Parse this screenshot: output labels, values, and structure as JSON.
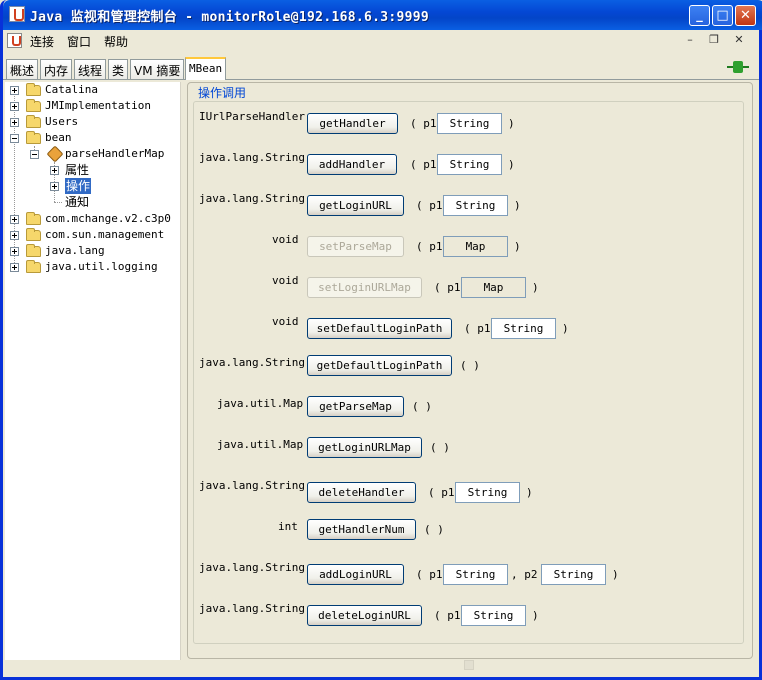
{
  "window": {
    "title": "Java 监视和管理控制台 - monitorRole@192.168.6.3:9999",
    "minimize": "_",
    "maximize": "□",
    "close": "✕"
  },
  "menu": {
    "items": [
      "连接",
      "窗口",
      "帮助"
    ],
    "mdi_minimize": "–",
    "mdi_restore": "❐",
    "mdi_close": "✕"
  },
  "tabs": [
    "概述",
    "内存",
    "线程",
    "类",
    "VM 摘要",
    "MBean"
  ],
  "active_tab": "MBean",
  "tree": {
    "nodes": [
      {
        "label": "Catalina",
        "expanded": false
      },
      {
        "label": "JMImplementation",
        "expanded": false
      },
      {
        "label": "Users",
        "expanded": false
      },
      {
        "label": "bean",
        "expanded": true
      },
      {
        "label": "parseHandlerMap",
        "expanded": true
      },
      {
        "label": "属性",
        "expanded": false
      },
      {
        "label": "操作",
        "expanded": false,
        "selected": true
      },
      {
        "label": "通知"
      },
      {
        "label": "com.mchange.v2.c3p0",
        "expanded": false
      },
      {
        "label": "com.sun.management",
        "expanded": false
      },
      {
        "label": "java.lang",
        "expanded": false
      },
      {
        "label": "java.util.logging",
        "expanded": false
      }
    ]
  },
  "operations": {
    "title": "操作调用",
    "rows": [
      {
        "return_type": "IUrlParseHandler",
        "name": "getHandler",
        "enabled": true,
        "open": "( p1",
        "params": [
          "String"
        ],
        "close": ")"
      },
      {
        "return_type": "java.lang.String",
        "name": "addHandler",
        "enabled": true,
        "open": "( p1",
        "params": [
          "String"
        ],
        "close": ")"
      },
      {
        "return_type": "java.lang.String",
        "name": "getLoginURL",
        "enabled": true,
        "open": "( p1",
        "params": [
          "String"
        ],
        "close": ")"
      },
      {
        "return_type": "void",
        "name": "setParseMap",
        "enabled": false,
        "open": "( p1",
        "params": [
          "Map"
        ],
        "close": ")"
      },
      {
        "return_type": "void",
        "name": "setLoginURLMap",
        "enabled": false,
        "open": "( p1",
        "params": [
          "Map"
        ],
        "close": ")"
      },
      {
        "return_type": "void",
        "name": "setDefaultLoginPath",
        "enabled": true,
        "open": "( p1",
        "params": [
          "String"
        ],
        "close": ")"
      },
      {
        "return_type": "java.lang.String",
        "name": "getDefaultLoginPath",
        "enabled": true,
        "empty_params": "( )"
      },
      {
        "return_type": "java.util.Map",
        "name": "getParseMap",
        "enabled": true,
        "empty_params": "( )"
      },
      {
        "return_type": "java.util.Map",
        "name": "getLoginURLMap",
        "enabled": true,
        "empty_params": "( )"
      },
      {
        "return_type": "java.lang.String",
        "name": "deleteHandler",
        "enabled": true,
        "open": "( p1",
        "params": [
          "String"
        ],
        "close": ")"
      },
      {
        "return_type": "int",
        "name": "getHandlerNum",
        "enabled": true,
        "empty_params": "( )"
      },
      {
        "return_type": "java.lang.String",
        "name": "addLoginURL",
        "enabled": true,
        "open": "( p1",
        "params": [
          "String",
          "String"
        ],
        "sep": ", p2",
        "close": ")"
      },
      {
        "return_type": "java.lang.String",
        "name": "deleteLoginURL",
        "enabled": true,
        "open": "( p1",
        "params": [
          "String"
        ],
        "close": ")"
      }
    ]
  }
}
